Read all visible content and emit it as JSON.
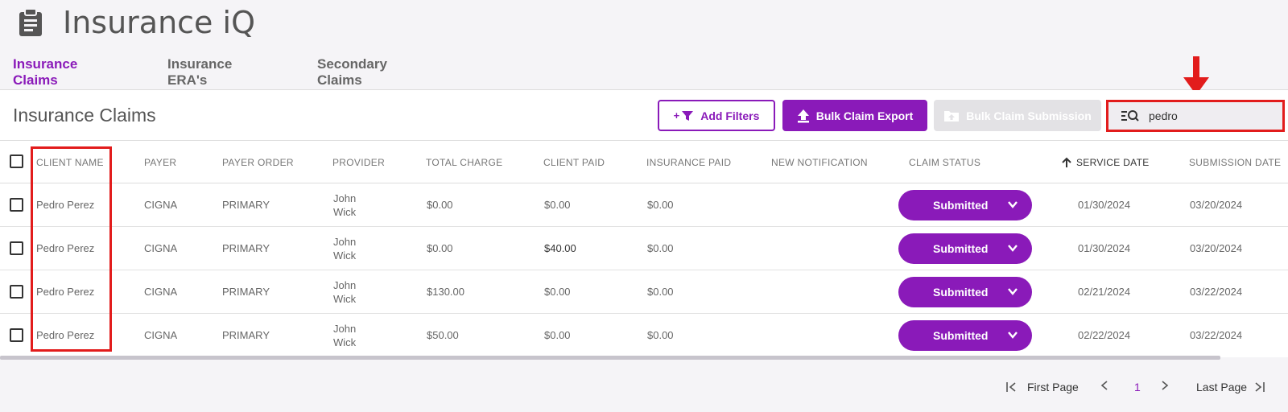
{
  "app": {
    "title": "Insurance iQ",
    "icon": "clipboard-icon"
  },
  "tabs": [
    {
      "label": "Insurance Claims",
      "active": true
    },
    {
      "label": "Insurance ERA's",
      "active": false
    },
    {
      "label": "Secondary Claims",
      "active": false
    }
  ],
  "panel": {
    "title": "Insurance Claims",
    "add_filters_label": "Add Filters",
    "add_filters_prefix": "+",
    "bulk_export_label": "Bulk Claim Export",
    "bulk_submission_label": "Bulk Claim Submission",
    "search": {
      "value": "pedro",
      "placeholder": ""
    }
  },
  "table": {
    "columns": [
      "CLIENT NAME",
      "PAYER",
      "PAYER ORDER",
      "PROVIDER",
      "TOTAL CHARGE",
      "CLIENT PAID",
      "INSURANCE PAID",
      "NEW NOTIFICATION",
      "CLAIM STATUS",
      "SERVICE DATE",
      "SUBMISSION DATE"
    ],
    "sort": {
      "column": "SERVICE DATE",
      "direction": "ascending"
    },
    "rows": [
      {
        "client_name": "Pedro Perez",
        "payer": "CIGNA",
        "payer_order": "PRIMARY",
        "provider_first": "John",
        "provider_last": "Wick",
        "total_charge": "$0.00",
        "client_paid": "$0.00",
        "insurance_paid": "$0.00",
        "new_notification": "",
        "claim_status": "Submitted",
        "service_date": "01/30/2024",
        "submission_date": "03/20/2024"
      },
      {
        "client_name": "Pedro Perez",
        "payer": "CIGNA",
        "payer_order": "PRIMARY",
        "provider_first": "John",
        "provider_last": "Wick",
        "total_charge": "$0.00",
        "client_paid": "$40.00",
        "insurance_paid": "$0.00",
        "new_notification": "",
        "claim_status": "Submitted",
        "service_date": "01/30/2024",
        "submission_date": "03/20/2024"
      },
      {
        "client_name": "Pedro Perez",
        "payer": "CIGNA",
        "payer_order": "PRIMARY",
        "provider_first": "John",
        "provider_last": "Wick",
        "total_charge": "$130.00",
        "client_paid": "$0.00",
        "insurance_paid": "$0.00",
        "new_notification": "",
        "claim_status": "Submitted",
        "service_date": "02/21/2024",
        "submission_date": "03/22/2024"
      },
      {
        "client_name": "Pedro Perez",
        "payer": "CIGNA",
        "payer_order": "PRIMARY",
        "provider_first": "John",
        "provider_last": "Wick",
        "total_charge": "$50.00",
        "client_paid": "$0.00",
        "insurance_paid": "$0.00",
        "new_notification": "",
        "claim_status": "Submitted",
        "service_date": "02/22/2024",
        "submission_date": "03/22/2024"
      }
    ]
  },
  "pagination": {
    "first_label": "First Page",
    "current_page": "1",
    "last_label": "Last Page"
  },
  "colors": {
    "accent": "#8a1ab9",
    "annotation": "#e21c1c",
    "disabled": "#e3e2e5"
  }
}
